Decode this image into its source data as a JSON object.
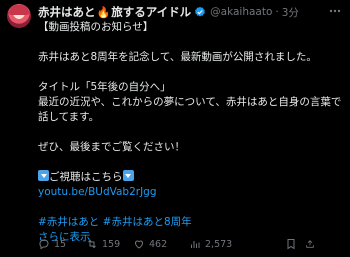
{
  "tweet": {
    "display_name": "赤井はあと",
    "display_name_suffix": "旅するアイドル",
    "handle": "@akaihaato",
    "separator": "·",
    "time": "3分",
    "body_lines": [
      "【動画投稿のお知らせ】",
      "",
      "赤井はあと8周年を記念して、最新動画が公開されました。",
      "",
      "タイトル「5年後の自分へ」",
      "最近の近況や、これからの夢について、赤井はあと自身の言葉で",
      "話してます。",
      "",
      "ぜひ、最後までご覧ください！",
      ""
    ],
    "cta_text": "ご視聴はこちら",
    "link": "youtu.be/BUdVab2rJgg",
    "hashtags": [
      "#赤井はあと",
      "#赤井はあと8周年"
    ],
    "show_more": "さらに表示"
  },
  "actions": {
    "reply_count": "15",
    "retweet_count": "159",
    "like_count": "462",
    "view_count": "2,573"
  },
  "icons": {
    "fire": "fire-icon",
    "verified": "verified-badge-icon",
    "more": "more-icon",
    "reply": "reply-icon",
    "retweet": "retweet-icon",
    "like": "heart-icon",
    "views": "views-chart-icon",
    "bookmark": "bookmark-icon",
    "share": "share-icon"
  },
  "colors": {
    "background": "#000000",
    "text": "#e7e9ea",
    "muted": "#71767b",
    "link": "#1d9bf0",
    "verified": "#1d9bf0"
  }
}
